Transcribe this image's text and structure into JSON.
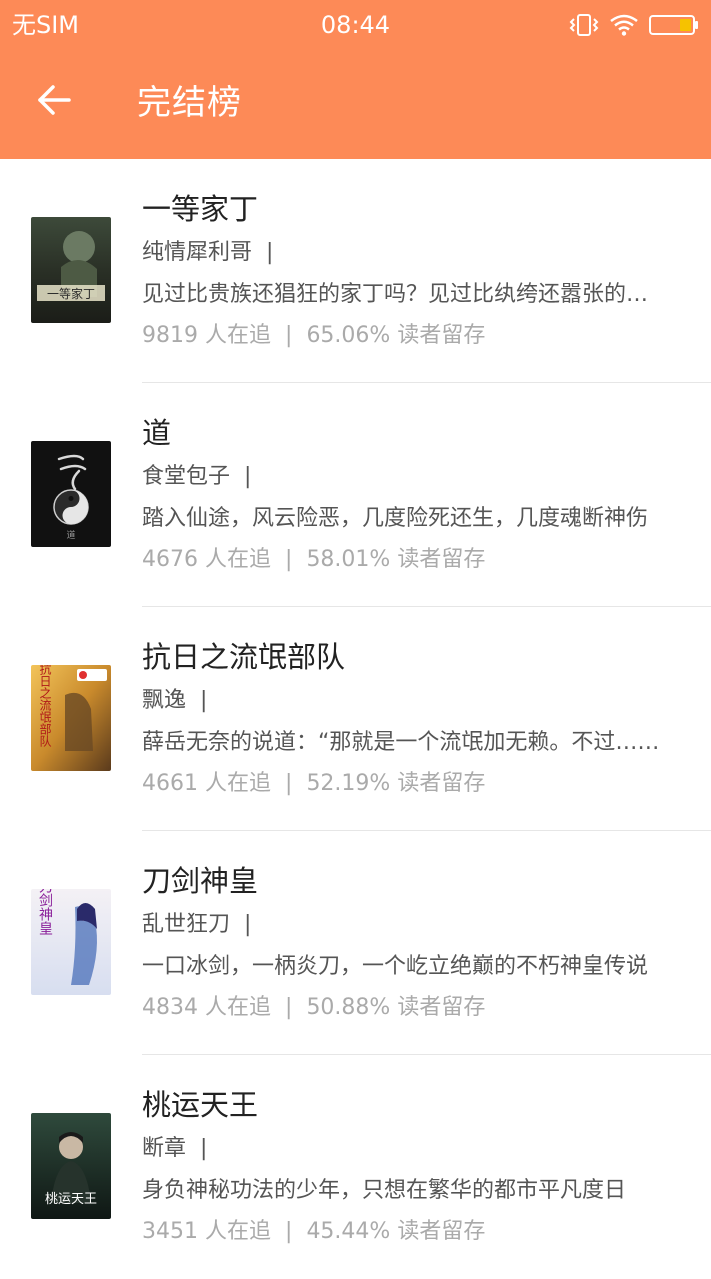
{
  "status_bar": {
    "carrier": "无SIM",
    "time": "08:44",
    "icons": [
      "vibrate-icon",
      "wifi-icon",
      "battery-icon"
    ]
  },
  "header": {
    "back_icon": "arrow-left-icon",
    "title": "完结榜",
    "background_color": "#fd8a57"
  },
  "books": [
    {
      "title": "一等家丁",
      "author": "纯情犀利哥",
      "description": "见过比贵族还猖狂的家丁吗？见过比纨绔还嚣张的家丁吗？",
      "followers": "9819",
      "followers_suffix": "人在追",
      "retention": "65.06%",
      "retention_suffix": "读者留存",
      "cover_text": "一等家丁"
    },
    {
      "title": "道",
      "author": "食堂包子",
      "description": "踏入仙途，风云险恶，几度险死还生，几度魂断神伤",
      "followers": "4676",
      "followers_suffix": "人在追",
      "retention": "58.01%",
      "retention_suffix": "读者留存",
      "cover_text": "道"
    },
    {
      "title": "抗日之流氓部队",
      "author": "飘逸",
      "description": "薛岳无奈的说道：“那就是一个流氓加无赖。不过……",
      "followers": "4661",
      "followers_suffix": "人在追",
      "retention": "52.19%",
      "retention_suffix": "读者留存",
      "cover_text": "抗日之流氓部队"
    },
    {
      "title": "刀剑神皇",
      "author": "乱世狂刀",
      "description": "一口冰剑，一柄炎刀，一个屹立绝巅的不朽神皇传说",
      "followers": "4834",
      "followers_suffix": "人在追",
      "retention": "50.88%",
      "retention_suffix": "读者留存",
      "cover_text": "刀剑神皇"
    },
    {
      "title": "桃运天王",
      "author": "断章",
      "description": "身负神秘功法的少年，只想在繁华的都市平凡度日",
      "followers": "3451",
      "followers_suffix": "人在追",
      "retention": "45.44%",
      "retention_suffix": "读者留存",
      "cover_text": "桃运天王"
    }
  ]
}
